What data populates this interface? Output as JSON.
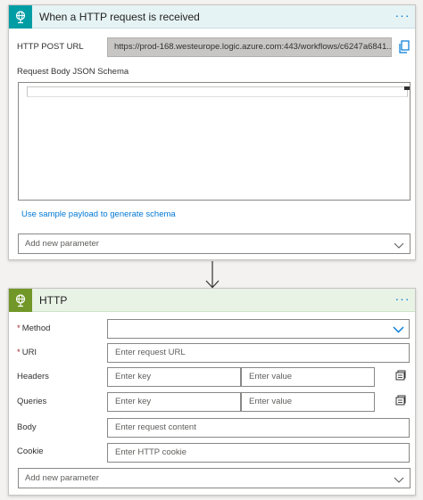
{
  "trigger": {
    "title": "When a HTTP request is received",
    "more_label": "···",
    "post_url_label": "HTTP POST URL",
    "post_url_value": "https://prod-168.westeurope.logic.azure.com:443/workflows/c6247a6841...",
    "schema_label": "Request Body JSON Schema",
    "sample_payload_link": "Use sample payload to generate schema",
    "add_param_placeholder": "Add new parameter"
  },
  "http": {
    "title": "HTTP",
    "more_label": "···",
    "required_mark": "*",
    "method_label": "Method",
    "method_value": "",
    "uri_label": "URI",
    "uri_placeholder": "Enter request URL",
    "headers_label": "Headers",
    "queries_label": "Queries",
    "key_placeholder": "Enter key",
    "value_placeholder": "Enter value",
    "body_label": "Body",
    "body_placeholder": "Enter request content",
    "cookie_label": "Cookie",
    "cookie_placeholder": "Enter HTTP cookie",
    "add_param_placeholder": "Add new parameter"
  },
  "colors": {
    "trigger_accent": "#009da5",
    "http_accent": "#709727",
    "link": "#0078d4",
    "required": "#a4262c"
  },
  "icons": {
    "trigger": "request-globe-icon",
    "http": "http-globe-icon",
    "copy": "copy-icon",
    "chevron": "chevron-down-icon",
    "switch_mode": "switch-to-text-mode-icon",
    "connector": "down-arrow-icon"
  }
}
